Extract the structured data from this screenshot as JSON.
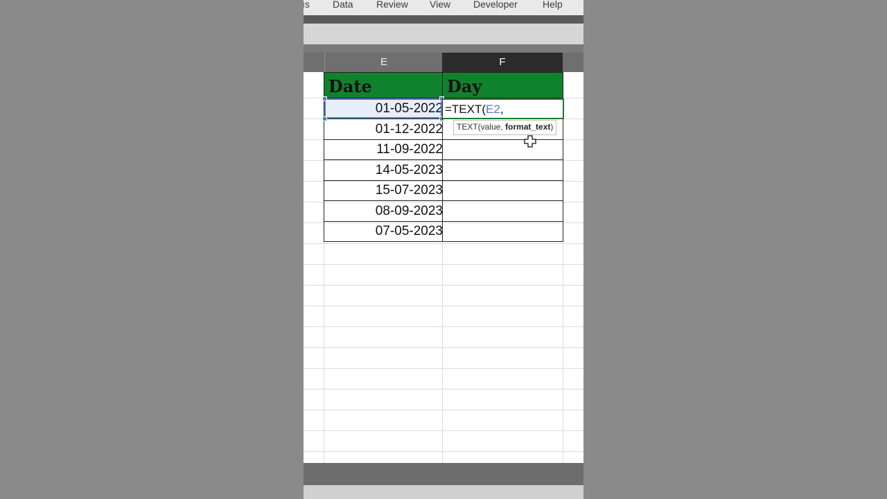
{
  "menubar": {
    "items": [
      {
        "label": "ıs"
      },
      {
        "label": "Data"
      },
      {
        "label": "Review"
      },
      {
        "label": "View"
      },
      {
        "label": "Developer"
      },
      {
        "label": "Help"
      }
    ]
  },
  "columns": {
    "e": "E",
    "f": "F"
  },
  "table": {
    "header_date": "Date",
    "header_day": "Day",
    "rows": [
      {
        "date": "01-05-2022"
      },
      {
        "date": "01-12-2022"
      },
      {
        "date": "11-09-2022"
      },
      {
        "date": "14-05-2023"
      },
      {
        "date": "15-07-2023"
      },
      {
        "date": "08-09-2023"
      },
      {
        "date": "07-05-2023"
      }
    ]
  },
  "editing": {
    "formula_prefix": "=TEXT(",
    "formula_ref": "E2",
    "formula_suffix": ","
  },
  "tooltip": {
    "prefix": "TEXT(value, ",
    "bold": "format_text",
    "suffix": ")"
  },
  "colors": {
    "header_green": "#10812c",
    "selection_blue": "#4f7fc4",
    "edit_border_green": "#1e7a34"
  }
}
